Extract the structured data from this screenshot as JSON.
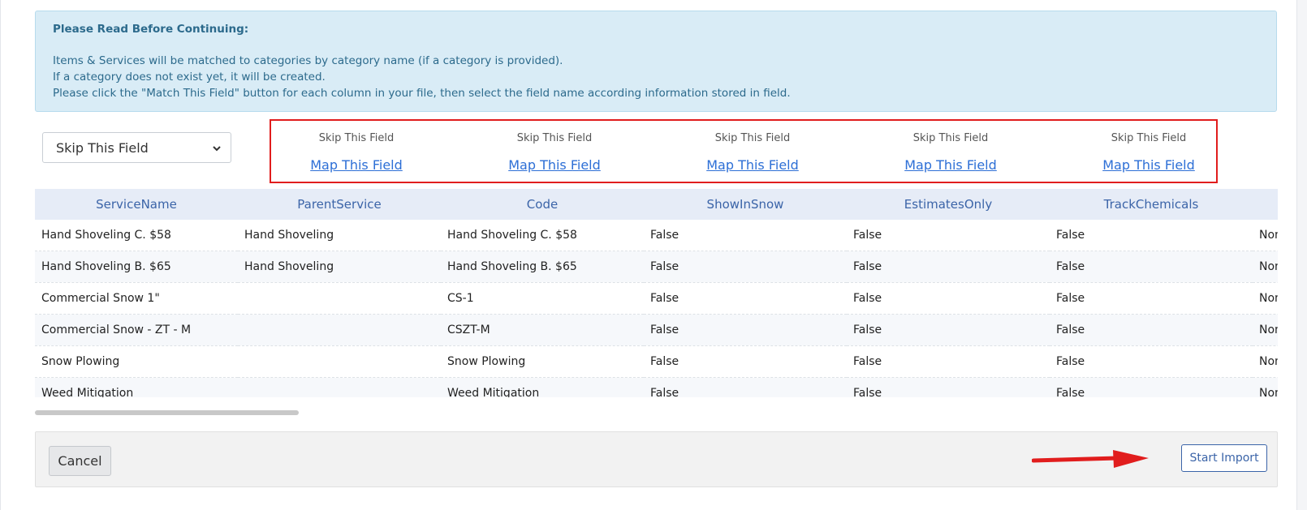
{
  "notice": {
    "title": "Please Read Before Continuing:",
    "lines": [
      "Items & Services will be matched to categories by category name (if a category is provided).",
      "If a category does not exist yet, it will be created.",
      "Please click the \"Match This Field\" button for each column in your file, then select the field name according information stored in field."
    ]
  },
  "field_select": {
    "value": "Skip This Field"
  },
  "mapping": {
    "columns": [
      {
        "skip": "Skip This Field",
        "map": "Map This Field"
      },
      {
        "skip": "Skip This Field",
        "map": "Map This Field"
      },
      {
        "skip": "Skip This Field",
        "map": "Map This Field"
      },
      {
        "skip": "Skip This Field",
        "map": "Map This Field"
      },
      {
        "skip": "Skip This Field",
        "map": "Map This Field"
      }
    ]
  },
  "table": {
    "headers": [
      "ServiceName",
      "ParentService",
      "Code",
      "ShowInSnow",
      "EstimatesOnly",
      "TrackChemicals",
      ""
    ],
    "rows": [
      [
        "Hand Shoveling C. $58",
        "Hand Shoveling",
        "Hand Shoveling C. $58",
        "False",
        "False",
        "False",
        "Non"
      ],
      [
        "Hand Shoveling B. $65",
        "Hand Shoveling",
        "Hand Shoveling B. $65",
        "False",
        "False",
        "False",
        "Non"
      ],
      [
        "Commercial Snow 1\"",
        "",
        "CS-1",
        "False",
        "False",
        "False",
        "Non"
      ],
      [
        "Commercial Snow - ZT - M",
        "",
        "CSZT-M",
        "False",
        "False",
        "False",
        "Non"
      ],
      [
        "Snow Plowing",
        "",
        "Snow Plowing",
        "False",
        "False",
        "False",
        "Non"
      ],
      [
        "Weed Mitigation",
        "",
        "Weed Mitigation",
        "False",
        "False",
        "False",
        "Non"
      ]
    ]
  },
  "footer": {
    "cancel": "Cancel",
    "start_import": "Start Import"
  },
  "colors": {
    "highlight_box": "#e11d1d",
    "link": "#2d6fd6",
    "accent": "#3b64a8"
  },
  "icons": {
    "select": "chevron-down-icon",
    "annotation": "red-arrow-icon"
  }
}
